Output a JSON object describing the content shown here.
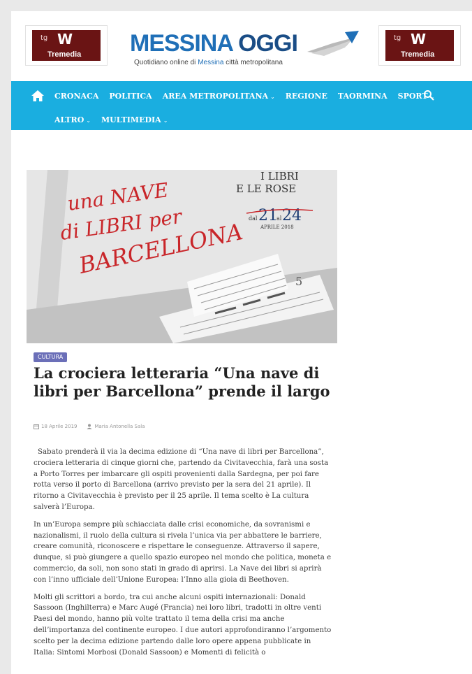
{
  "header": {
    "ad_left": {
      "prefix": "tg",
      "mark": "W",
      "name": "Tremedia"
    },
    "ad_right": {
      "prefix": "tg",
      "mark": "W",
      "name": "Tremedia"
    },
    "logo": {
      "title_part1": "MESSINA",
      "title_part2": " OGGI",
      "subtitle_before": "Quotidiano online di ",
      "subtitle_highlight": "Messina",
      "subtitle_after": " città metropolitana"
    }
  },
  "nav": {
    "items_row1": [
      {
        "label": "CRONACA"
      },
      {
        "label": "POLITICA"
      },
      {
        "label": "AREA METROPOLITANA"
      },
      {
        "label": "REGIONE"
      },
      {
        "label": "TAORMINA"
      },
      {
        "label": "SPORT"
      }
    ],
    "items_row2": [
      {
        "label": "ALTRO"
      },
      {
        "label": "MULTIMEDIA"
      }
    ],
    "caret": "⌄"
  },
  "hero": {
    "line1": "una NAVE",
    "line2": "di LIBRI per",
    "line3": "BARCELLONA",
    "right1": "I LIBRI",
    "right2": "E LE ROSE",
    "date_prefix": "dal",
    "date_from": "21",
    "date_mid": "al",
    "date_to": "24",
    "date_suffix": "APRILE 2018"
  },
  "article": {
    "category": "CULTURA",
    "title": "La crociera letteraria “Una nave di libri per Barcellona” prende il largo",
    "date": "18 Aprile 2019",
    "author": "Maria Antonella Sala",
    "paragraphs": [
      "Sabato prenderà il via  la decima edizione di “Una nave di libri per Barcellona”, crociera letteraria di cinque giorni che, partendo da Civitavecchia, farà una sosta a Porto Torres per imbarcare gli ospiti provenienti dalla Sardegna, per poi fare rotta verso il porto di Barcellona (arrivo previsto per la sera del 21 aprile). Il ritorno a Civitavecchia è previsto per il 25 aprile. Il tema scelto  è La cultura salverà l’Europa.",
      "In un’Europa sempre più schiacciata dalle crisi economiche, da sovranismi e nazionalismi, il ruolo della cultura si rivela l’unica via per abbattere le barriere, creare comunità, riconoscere e rispettare le conseguenze. Attraverso il sapere, dunque, si può giungere a quello spazio europeo nel mondo che politica, moneta e commercio, da soli, non sono stati in grado di aprirsi. La Nave dei libri si aprirà con l’inno ufficiale dell’Unione Europea: l’Inno alla gioia di Beethoven.",
      "Molti gli scrittori a bordo, tra cui anche alcuni ospiti internazionali: Donald Sassoon (Inghilterra) e Marc Augé (Francia) nei loro libri, tradotti in oltre venti Paesi del mondo, hanno più volte trattato il tema della crisi ma anche dell’importanza del continente europeo. I due autori approfondiranno l’argomento scelto per la decima edizione partendo dalle loro opere appena pubblicate in Italia: Sintomi Morbosi (Donald Sassoon) e Momenti di felicità o"
    ]
  },
  "colors": {
    "nav_bg": "#1aaee0",
    "brand_blue": "#1f6fb7",
    "category_badge": "#6b6fb8",
    "ad_bg": "#6a1414",
    "hero_red": "#c9262a"
  },
  "icons": {
    "home": "home-icon",
    "search": "search-icon",
    "calendar": "calendar-icon",
    "author": "user-icon"
  }
}
